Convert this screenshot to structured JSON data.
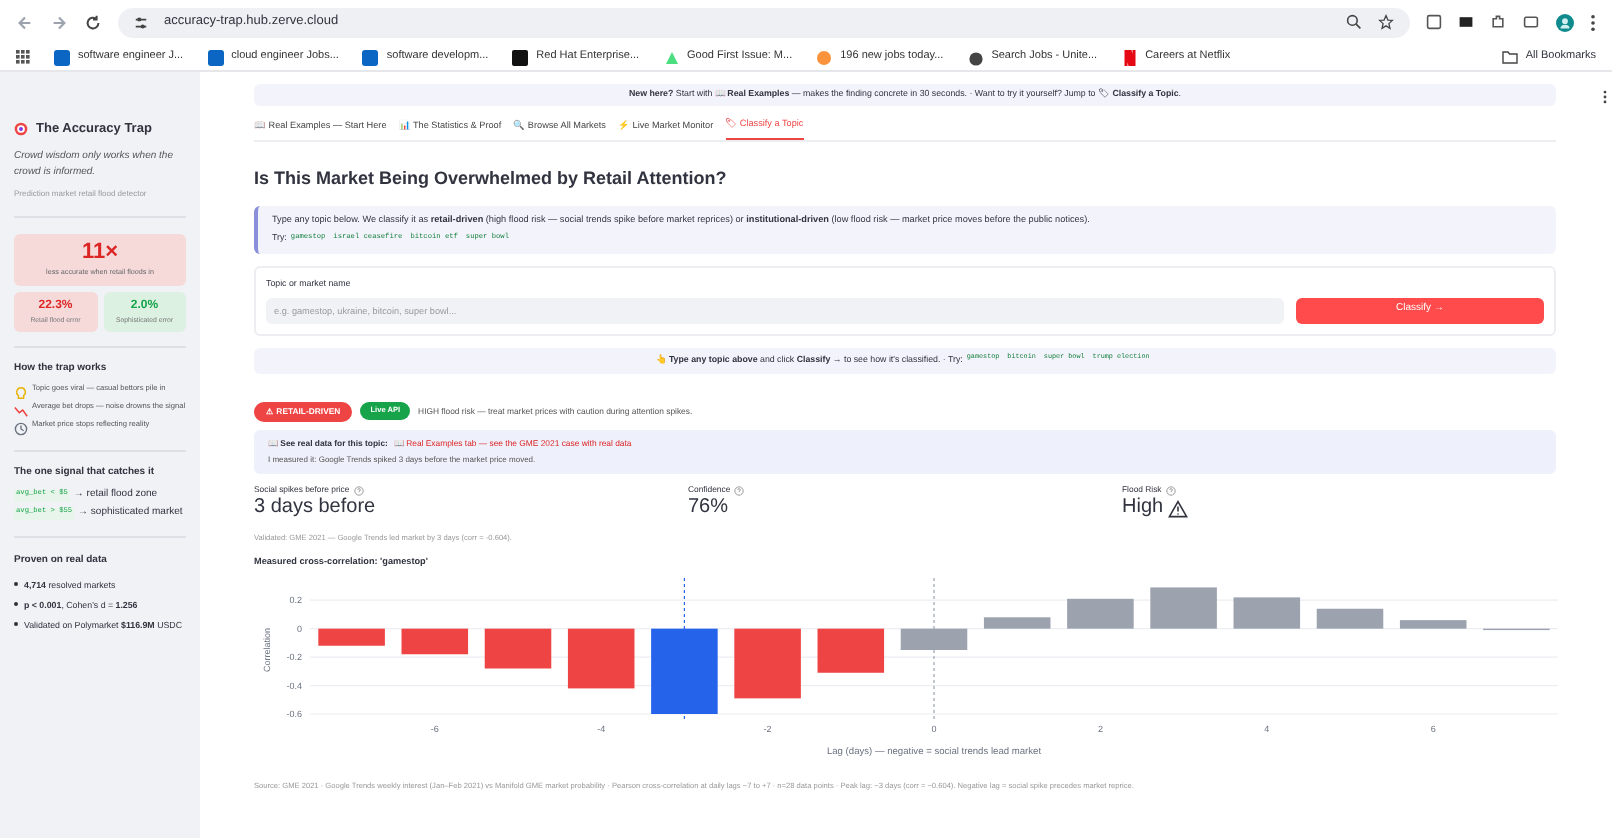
{
  "browser": {
    "url": "accuracy-trap.hub.zerve.cloud",
    "bookmarks": [
      {
        "label": "software engineer J...",
        "kind": "linkedin"
      },
      {
        "label": "cloud engineer Jobs...",
        "kind": "linkedin"
      },
      {
        "label": "software developm...",
        "kind": "linkedin"
      },
      {
        "label": "Red Hat Enterprise...",
        "kind": "dark"
      },
      {
        "label": "Good First Issue: M...",
        "kind": "green"
      },
      {
        "label": "196 new jobs today...",
        "kind": "orange"
      },
      {
        "label": "Search Jobs - Unite...",
        "kind": "apple"
      },
      {
        "label": "Careers at Netflix",
        "kind": "netflix"
      }
    ],
    "all_bookmarks": "All Bookmarks"
  },
  "sidebar": {
    "title": "The Accuracy Trap",
    "tagline": "Crowd wisdom only works when the crowd is informed.",
    "subtitle": "Prediction market retail flood detector",
    "hero": {
      "value": "11×",
      "caption": "less accurate when retail floods in"
    },
    "stats": [
      {
        "value": "22.3%",
        "caption": "Retail flood error",
        "kind": "bad"
      },
      {
        "value": "2.0%",
        "caption": "Sophisticated error",
        "kind": "good"
      }
    ],
    "how_title": "How the trap works",
    "how_steps": [
      {
        "text": "Topic goes viral — casual bettors pile in",
        "kind": "bulb"
      },
      {
        "text": "Average bet drops — noise drowns the signal",
        "kind": "trend"
      },
      {
        "text": "Market price stops reflecting reality",
        "kind": "clock"
      }
    ],
    "signal_title": "The one signal that catches it",
    "signals": [
      {
        "code": "avg_bet < $5",
        "text": "→ retail flood zone"
      },
      {
        "code": "avg_bet > $55",
        "text": "→ sophisticated market"
      }
    ],
    "proof_title": "Proven on real data",
    "proof": [
      "**4,714** resolved markets",
      "**p < 0.001**, Cohen's d = **1.256**",
      "Validated on Polymarket **$116.9M** USDC"
    ]
  },
  "banner": "**New here?** Start with 📖 **Real Examples** — makes the finding concrete in 30 seconds. · Want to try it yourself? Jump to 🏷 **Classify a Topic**.",
  "tabs": [
    {
      "label": "📖 Real Examples — Start Here",
      "selected": false
    },
    {
      "label": "📊 The Statistics & Proof",
      "selected": false
    },
    {
      "label": "🔍 Browse All Markets",
      "selected": false
    },
    {
      "label": "⚡ Live Market Monitor",
      "selected": false
    },
    {
      "label": "🏷 Classify a Topic",
      "selected": true
    }
  ],
  "heading": "Is This Market Being Overwhelmed by Retail Attention?",
  "intro": "Type any topic below. We classify it as **retail-driven** (high flood risk — social trends spike before market reprices) or **institutional-driven** (low flood risk — market price moves before the public notices).",
  "try_label": "Try:",
  "try_examples": [
    "gamestop",
    "israel ceasefire",
    "bitcoin etf",
    "super bowl"
  ],
  "input": {
    "label": "Topic or market name",
    "placeholder": "e.g. gamestop, ukraine, bitcoin, super bowl...",
    "button": "Classify →"
  },
  "hint": {
    "text": "👆 **Type any topic above** and click **Classify →** to see how it's classified. · Try:",
    "examples": [
      "gamestop",
      "bitcoin",
      "super bowl",
      "trump election"
    ]
  },
  "result": {
    "badge": "⚠ RETAIL-DRIVEN",
    "source": "Live API",
    "note": "HIGH flood risk — treat market prices with caution during attention spikes."
  },
  "real_data": {
    "label": "📖 See real data for this topic:",
    "link": "📖 Real Examples tab — see the GME 2021 case with real data",
    "note": "I measured it: Google Trends spiked 3 days before the market price moved."
  },
  "metrics": [
    {
      "label": "Social spikes before price",
      "value": "3 days before",
      "kind": "plain"
    },
    {
      "label": "Confidence",
      "value": "76%",
      "kind": "plain"
    },
    {
      "label": "Flood Risk",
      "value": "High",
      "kind": "warning"
    }
  ],
  "validated": "Validated: GME 2021 — Google Trends led market by 3 days (corr = -0.604).",
  "chart": {
    "title": "Measured cross-correlation: 'gamestop'",
    "chart_data": {
      "type": "bar",
      "xlabel": "Lag (days) — negative = social trends lead market",
      "ylabel": "Correlation",
      "stacked": true,
      "x": [
        -7,
        -6,
        -5,
        -4,
        -3,
        -2,
        -1,
        0,
        1,
        2,
        3,
        4,
        5,
        6,
        7
      ],
      "series": [
        {
          "color": "#ef4444",
          "values": [
            -0.12,
            -0.18,
            -0.28,
            -0.42,
            null,
            -0.49,
            -0.31,
            null,
            null,
            null,
            null,
            null,
            null,
            null,
            null
          ]
        },
        {
          "color": "#2563eb",
          "values": [
            null,
            null,
            null,
            null,
            -0.6,
            null,
            null,
            null,
            null,
            null,
            null,
            null,
            null,
            null,
            null
          ]
        },
        {
          "color": "#9ca3af",
          "values": [
            null,
            null,
            null,
            null,
            null,
            null,
            null,
            -0.15,
            0.08,
            0.21,
            0.29,
            0.22,
            0.14,
            0.06,
            -0.01
          ]
        }
      ],
      "grid": true,
      "ref_lines": [
        {
          "axis": "x",
          "value": 0,
          "color": "#9ca3af"
        },
        {
          "axis": "x",
          "value": -3,
          "color": "#2563eb"
        }
      ],
      "xlim": [
        -7.5,
        7.5
      ],
      "ylim": [
        -0.6,
        0.3
      ],
      "xticks": [
        -6,
        -4,
        -2,
        0,
        2,
        4,
        6
      ],
      "yticks": [
        -0.6,
        -0.4,
        -0.2,
        0,
        0.2
      ]
    }
  },
  "source": "Source: GME 2021 · Google Trends weekly interest (Jan–Feb 2021) vs Manifold GME market probability · Pearson cross-correlation at daily lags −7 to +7 · n=28 data points · Peak lag: −3 days (corr = −0.604). Negative lag = social spike precedes market reprice."
}
